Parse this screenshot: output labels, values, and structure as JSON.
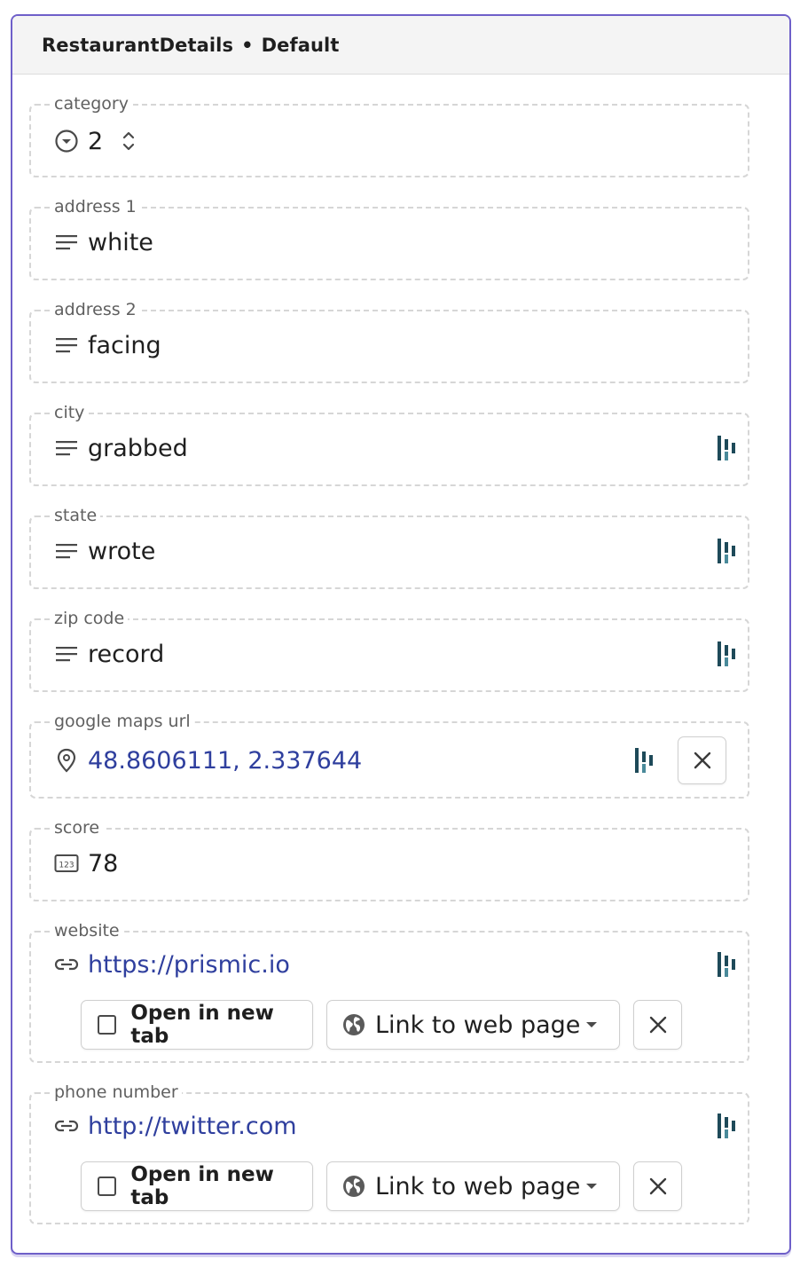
{
  "header": {
    "component": "RestaurantDetails",
    "separator": "•",
    "variation": "Default"
  },
  "fields": {
    "category": {
      "label": "category",
      "value": "2",
      "icon": "select-icon"
    },
    "address1": {
      "label": "address 1",
      "value": "white",
      "icon": "text-lines-icon"
    },
    "address2": {
      "label": "address 2",
      "value": "facing",
      "icon": "text-lines-icon"
    },
    "city": {
      "label": "city",
      "value": "grabbed",
      "icon": "text-lines-icon"
    },
    "state": {
      "label": "state",
      "value": "wrote",
      "icon": "text-lines-icon"
    },
    "zip": {
      "label": "zip code",
      "value": "record",
      "icon": "text-lines-icon"
    },
    "maps": {
      "label": "google maps url",
      "value": "48.8606111, 2.337644",
      "icon": "location-pin-icon"
    },
    "score": {
      "label": "score",
      "value": "78",
      "icon": "number-icon"
    },
    "website": {
      "label": "website",
      "value": "https://prismic.io",
      "icon": "link-icon",
      "new_tab_label": "Open in new tab",
      "link_type_label": "Link to web page"
    },
    "phone": {
      "label": "phone number",
      "value": "http://twitter.com",
      "icon": "link-icon",
      "new_tab_label": "Open in new tab",
      "link_type_label": "Link to web page"
    }
  },
  "colors": {
    "accent_border": "#6e5fc9",
    "link_text": "#2f3f9e",
    "prismic_icon": "#1e4a59"
  }
}
